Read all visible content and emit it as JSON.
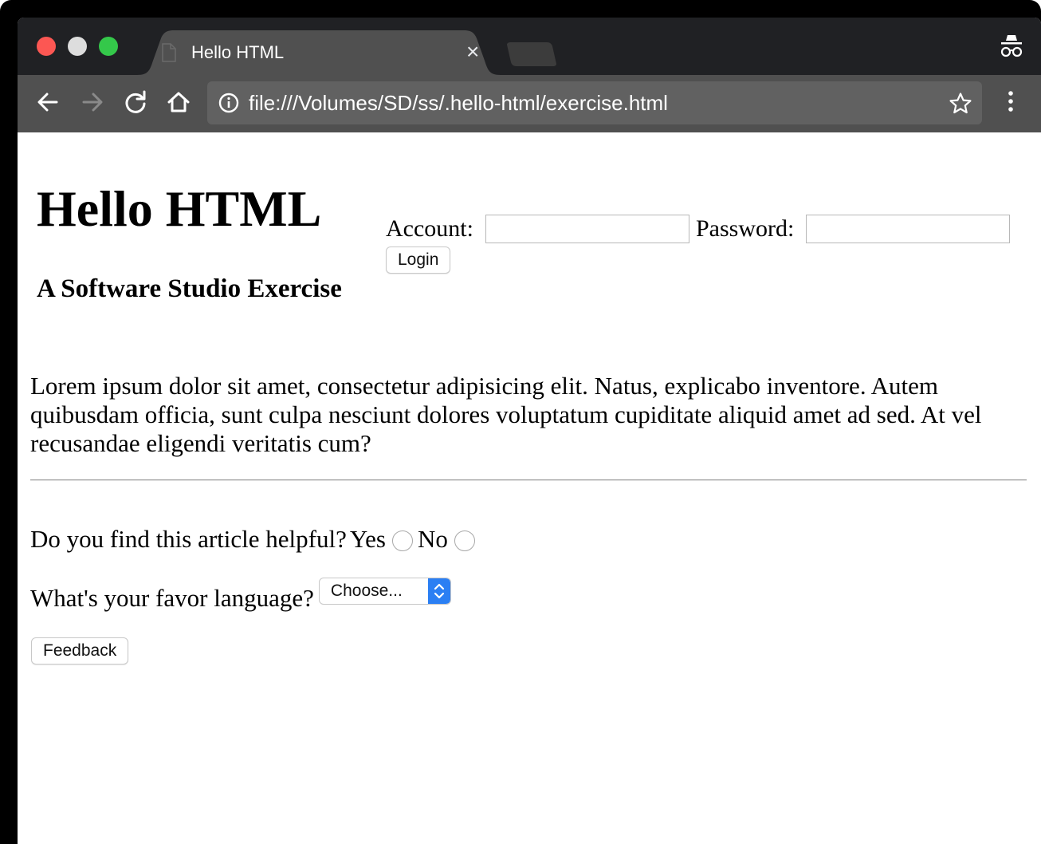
{
  "browser": {
    "tab_title": "Hello HTML",
    "tab_close": "×",
    "url": "file:///Volumes/SD/ss/.hello-html/exercise.html",
    "icons": [
      "back-icon",
      "forward-icon",
      "reload-icon",
      "home-icon",
      "info-icon",
      "star-icon",
      "menu-icon",
      "incognito-icon"
    ]
  },
  "page": {
    "title": "Hello HTML",
    "subtitle": "A Software Studio Exercise",
    "login": {
      "account_label": "Account:",
      "account_value": "",
      "password_label": "Password:",
      "password_value": "",
      "login_button": "Login"
    },
    "paragraph": "Lorem ipsum dolor sit amet, consectetur adipisicing elit. Natus, explicabo inventore. Autem quibusdam officia, sunt culpa nesciunt dolores voluptatum cupiditate aliquid amet ad sed. At vel recusandae eligendi veritatis cum?",
    "helpful": {
      "question": "Do you find this article helpful?",
      "yes_label": "Yes",
      "no_label": "No"
    },
    "language": {
      "question": "What's your favor language?",
      "selected": "Choose..."
    },
    "feedback_button": "Feedback"
  }
}
